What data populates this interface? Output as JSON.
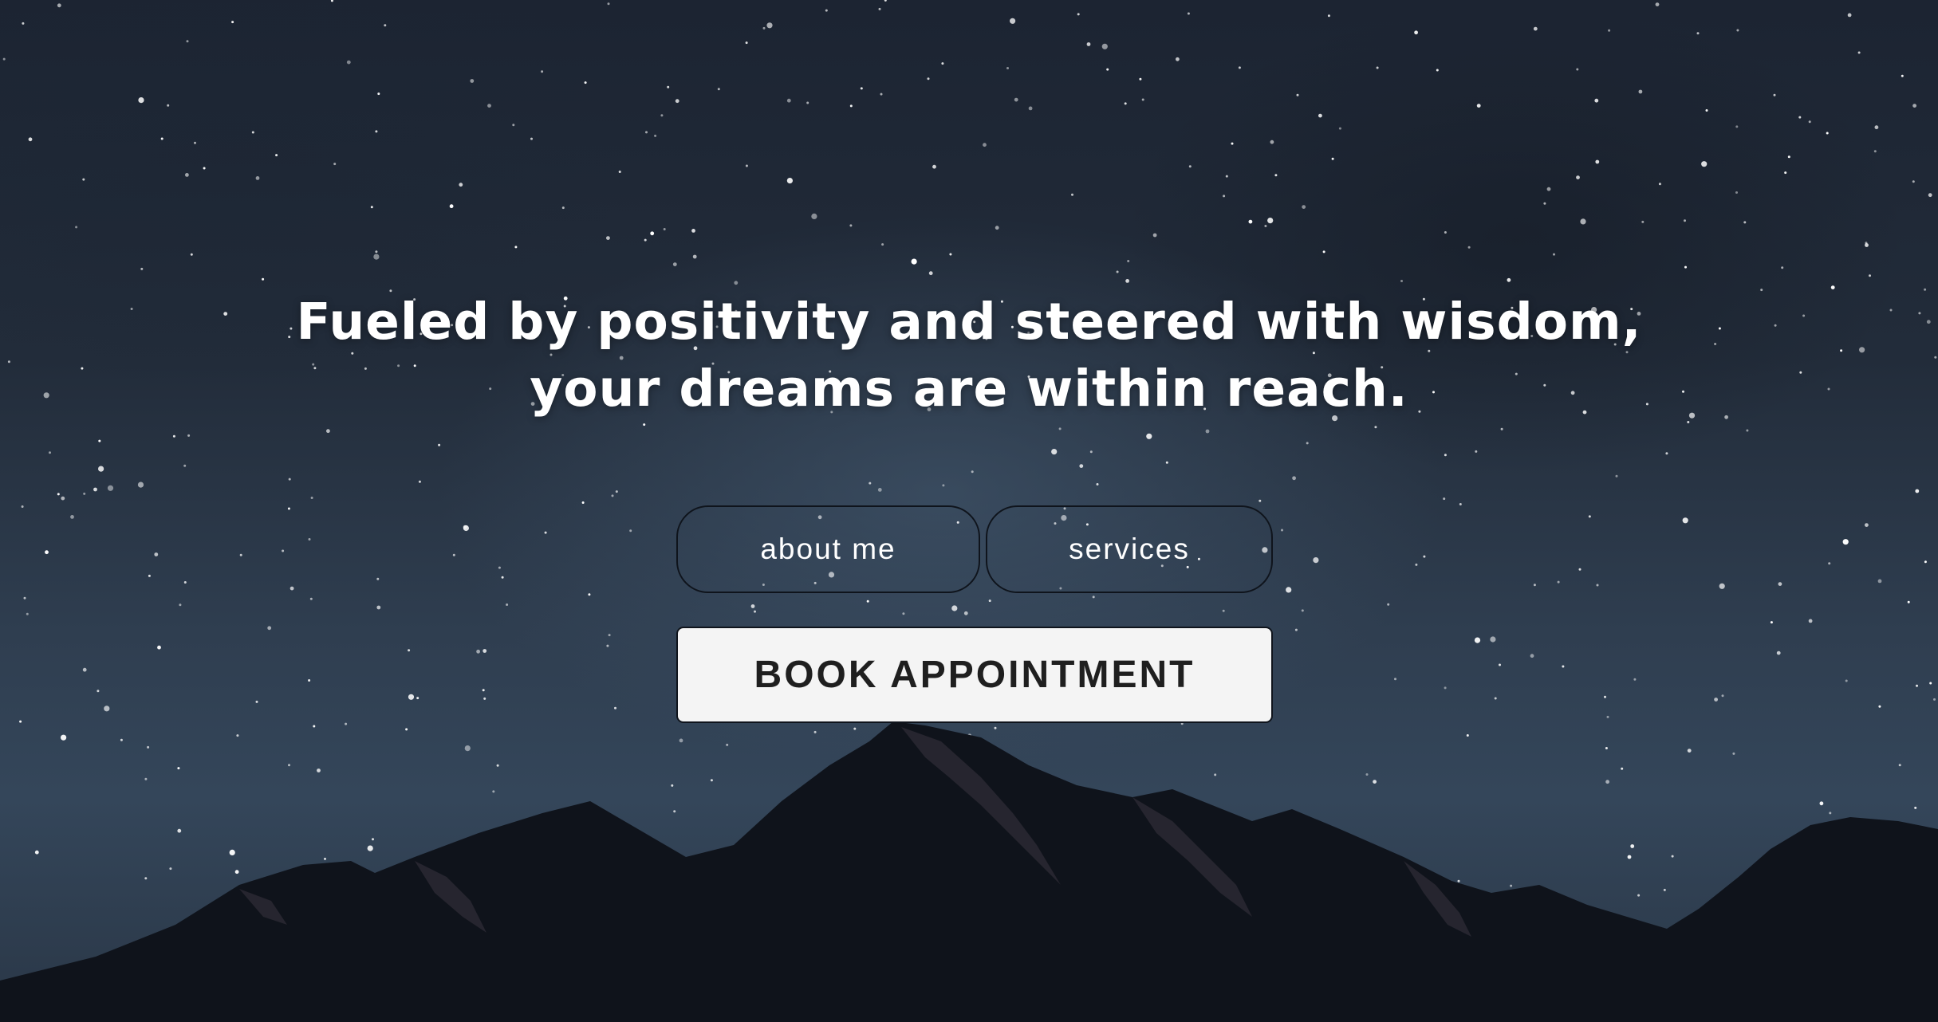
{
  "hero": {
    "headline_line1": "Fueled by positivity and steered with wisdom,",
    "headline_line2": "your dreams are within reach.",
    "about_label": "about me",
    "services_label": "services",
    "book_label": "BOOK APPOINTMENT"
  },
  "colors": {
    "sky_top": "#1c2432",
    "sky_bottom": "#34465a",
    "mountain": "#0f131b",
    "mountain_highlight": "#3a3440",
    "headline_text": "#ffffff",
    "button_fill": "#f4f4f4",
    "button_text": "#1f1f1f",
    "outline": "#0f141c"
  },
  "background": {
    "icon": "starry-mountain-night-icon"
  }
}
